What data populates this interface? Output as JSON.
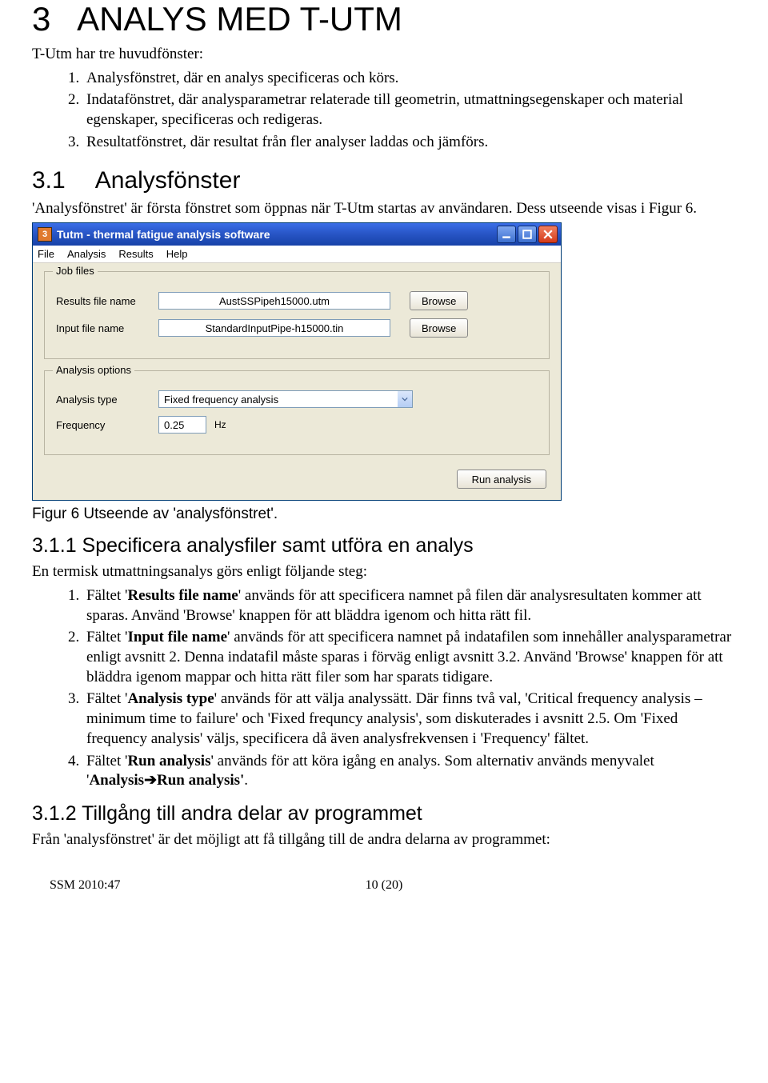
{
  "chapter": {
    "number": "3",
    "title": "ANALYS MED T-UTM"
  },
  "intro": "T-Utm har tre huvudfönster:",
  "windows_list": [
    "Analysfönstret, där en analys specificeras och körs.",
    "Indatafönstret, där analysparametrar relaterade till geometrin, utmattningsegenskaper och material egenskaper, specificeras och redigeras.",
    "Resultatfönstret, där resultat från fler analyser laddas och jämförs."
  ],
  "section31": {
    "num": "3.1",
    "title": "Analysfönster",
    "body": "'Analysfönstret' är första fönstret som öppnas när T-Utm startas av användaren. Dess utseende visas i Figur 6."
  },
  "app": {
    "title_glyph": "3",
    "title": "Tutm - thermal fatigue analysis software",
    "menus": [
      "File",
      "Analysis",
      "Results",
      "Help"
    ],
    "group_jobfiles": "Job files",
    "results_label": "Results file name",
    "results_value": "AustSSPipeh15000.utm",
    "input_label": "Input file name",
    "input_value": "StandardInputPipe-h15000.tin",
    "browse": "Browse",
    "group_opts": "Analysis options",
    "analysis_type_label": "Analysis type",
    "analysis_type_value": "Fixed frequency analysis",
    "frequency_label": "Frequency",
    "frequency_value": "0.25",
    "hz": "Hz",
    "run": "Run analysis"
  },
  "fig6_caption": "Figur 6 Utseende av 'analysfönstret'.",
  "section311": {
    "title": "3.1.1 Specificera analysfiler samt utföra en analys",
    "lead": "En termisk utmattningsanalys görs enligt följande steg:",
    "items": [
      {
        "bold": "Results file name",
        "pre": "Fältet '",
        "post": "' används för att specificera namnet på filen där analysresultaten kommer att sparas. Använd 'Browse' knappen för att bläddra igenom och hitta rätt fil."
      },
      {
        "bold": "Input file name",
        "pre": "Fältet '",
        "post": "' används för att specificera namnet på indatafilen som innehåller analysparametrar enligt avsnitt 2.  Denna indatafil måste sparas i förväg enligt avsnitt 3.2. Använd 'Browse' knappen för att bläddra igenom  mappar och hitta rätt filer som har sparats tidigare."
      },
      {
        "bold": "Analysis type",
        "pre": "Fältet '",
        "post": "' används för att välja analyssätt.  Där finns två val, 'Critical frequency analysis – minimum time to failure' och 'Fixed frequncy analysis', som diskuterades i avsnitt 2.5. Om 'Fixed frequency analysis' väljs, specificera då även analysfrekvensen i 'Frequency' fältet."
      },
      {
        "bold": "Run analysis",
        "pre": "Fältet '",
        "post": "' används för att köra igång en analys. Som alternativ används menyvalet '",
        "bold2": "Analysis➔Run analysis'",
        "tail": "."
      }
    ]
  },
  "section312": {
    "title": "3.1.2 Tillgång till andra delar av programmet",
    "body": "Från 'analysfönstret' är det möjligt att få tillgång till de andra delarna av programmet:"
  },
  "footer": {
    "left": "SSM 2010:47",
    "center": "10 (20)"
  }
}
